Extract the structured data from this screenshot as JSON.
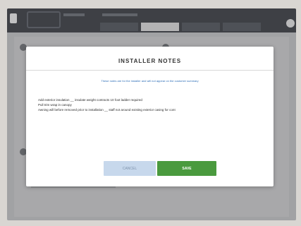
{
  "modal": {
    "title": "INSTALLER NOTES",
    "subtitle": "These notes are for the installer and will not appear on the customer summary",
    "notes": [
      "Add exterior insulation __ insulate weight contracts 10 foot ladder required",
      "Pull trim wrap in canopy",
      "Awning will before removed prior to installation __ staff not around existing exterior casing for cont"
    ],
    "cancel_label": "CANCEL",
    "save_label": "SAVE"
  },
  "colors": {
    "topbar": "#3b3e43",
    "save_button": "#4a9a3e",
    "cancel_button": "#c7d8ec",
    "subtitle_text": "#2f6fb8"
  },
  "icons": {
    "back": "back-arrow-icon",
    "profile": "profile-icon"
  }
}
